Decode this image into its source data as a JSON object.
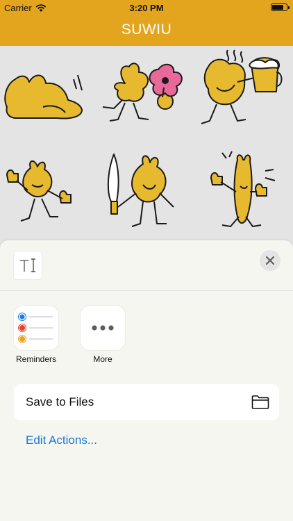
{
  "status_bar": {
    "carrier": "Carrier",
    "time": "3:20 PM",
    "battery_level": 0.85
  },
  "nav": {
    "title": "SUWIU"
  },
  "stickers": [
    {
      "name": "sticker-lying-down"
    },
    {
      "name": "sticker-flower"
    },
    {
      "name": "sticker-beer"
    },
    {
      "name": "sticker-thumbs-up"
    },
    {
      "name": "sticker-knife"
    },
    {
      "name": "sticker-tall-thumbs-up"
    }
  ],
  "share_sheet": {
    "apps": [
      {
        "label": "Reminders",
        "icon": "reminders-icon"
      },
      {
        "label": "More",
        "icon": "more-icon"
      }
    ],
    "actions": [
      {
        "label": "Save to Files",
        "icon": "folder-icon"
      }
    ],
    "edit_actions_label": "Edit Actions...",
    "colors": {
      "accent": "#1479d6",
      "brand": "#e3a41e",
      "sticker_fill": "#e6b92e"
    }
  }
}
